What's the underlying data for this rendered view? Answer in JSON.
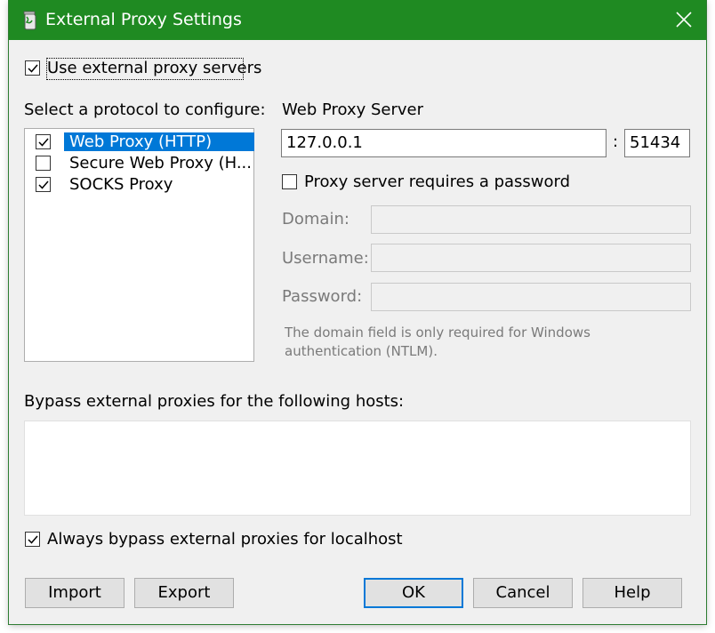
{
  "window": {
    "title": "External Proxy Settings",
    "title_color": "#1f8a22"
  },
  "use_external": {
    "label": "Use external proxy servers",
    "checked": true
  },
  "protocol": {
    "heading": "Select a protocol to configure:",
    "items": [
      {
        "label": "Web Proxy (HTTP)",
        "checked": true,
        "selected": true
      },
      {
        "label": "Secure Web Proxy (H...",
        "checked": false,
        "selected": false
      },
      {
        "label": "SOCKS Proxy",
        "checked": true,
        "selected": false
      }
    ]
  },
  "server": {
    "heading": "Web Proxy Server",
    "host": "127.0.0.1",
    "separator": ":",
    "port": "51434"
  },
  "auth": {
    "requires_password_label": "Proxy server requires a password",
    "requires_password": false,
    "domain_label": "Domain:",
    "username_label": "Username:",
    "password_label": "Password:",
    "note_line1": "The domain field is only required for Windows",
    "note_line2": "authentication (NTLM)."
  },
  "bypass": {
    "heading": "Bypass external proxies for the following hosts:",
    "hosts": "",
    "localhost_label": "Always bypass external proxies for localhost",
    "localhost_checked": true
  },
  "buttons": {
    "import": "Import",
    "export": "Export",
    "ok": "OK",
    "cancel": "Cancel",
    "help": "Help"
  },
  "colors": {
    "selection": "#0078d7",
    "accent": "#1f8a22"
  }
}
